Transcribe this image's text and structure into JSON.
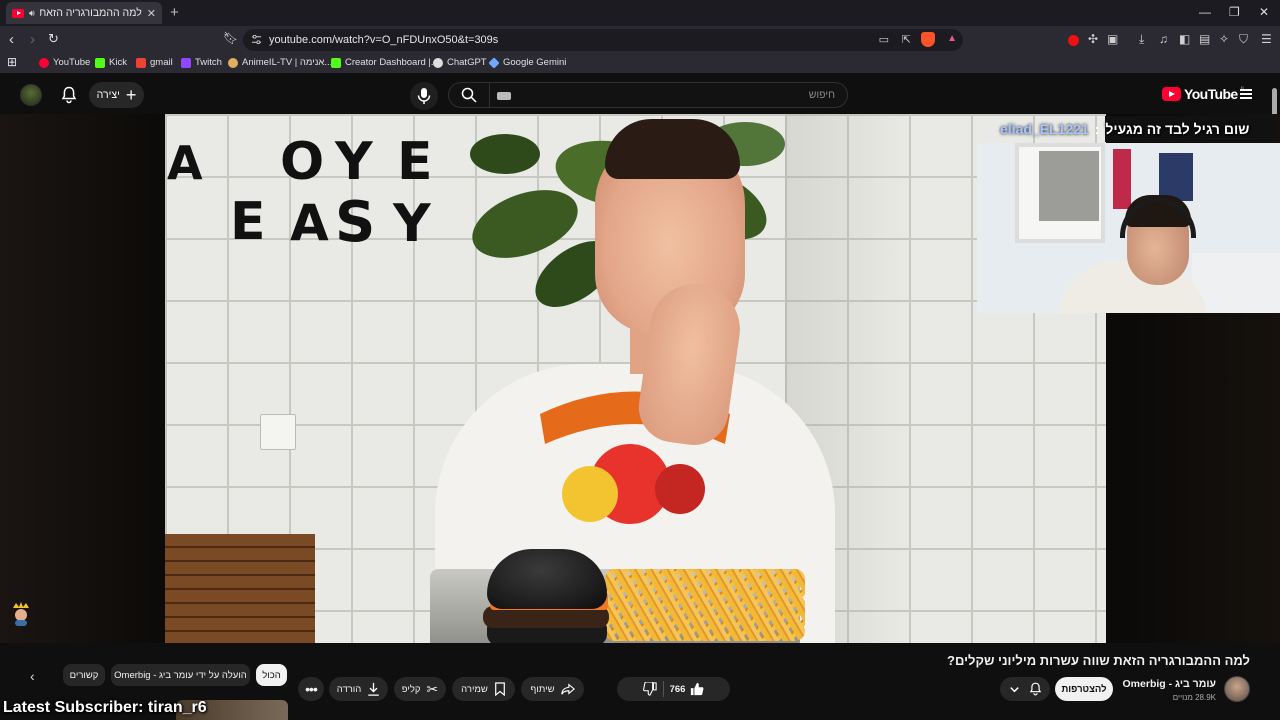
{
  "browser": {
    "tab_title": "למה ההמבורגריה הזאת שווה",
    "url": "youtube.com/watch?v=O_nFDUnxO50&t=309s",
    "bookmarks": [
      {
        "label": "YouTube",
        "color": "#ff0033"
      },
      {
        "label": "Kick",
        "color": "#53fc18"
      },
      {
        "label": "gmail",
        "color": "#ea4335"
      },
      {
        "label": "Twitch",
        "color": "#9146ff"
      },
      {
        "label": "AnimeIL-TV | אנימה...",
        "color": "#e0b060"
      },
      {
        "label": "Creator Dashboard |...",
        "color": "#53fc18"
      },
      {
        "label": "ChatGPT",
        "color": "#dddddd"
      },
      {
        "label": "Google Gemini",
        "color": "#6fa8ff"
      }
    ]
  },
  "youtube": {
    "create_label": "יצירה",
    "search_placeholder": "חיפוש",
    "logo_text": "YouTube",
    "logo_sup": "IL"
  },
  "overlay": {
    "chat_user": "eliad_EL1221",
    "chat_sep": ":",
    "chat_message": "שום רגיל לבד זה מגעיל",
    "video_wall_letters_1": [
      "A",
      "O",
      "Y",
      "E"
    ],
    "video_wall_letters_2": [
      "E",
      "A",
      "S",
      "Y"
    ],
    "latest_subscriber": "Latest Subscriber: tiran_r6"
  },
  "video": {
    "title": "למה ההמבורגריה הזאת שווה עשרות מיליוני שקלים?",
    "channel_name": "עומר ביג - Omerbig",
    "channel_subs": "28.9K מנויים",
    "join_label": "להצטרפות",
    "likes": "766",
    "share_label": "שיתוף",
    "save_label": "שמירה",
    "clip_label": "קליפ",
    "download_label": "הורדה"
  },
  "chips": [
    {
      "label": "הכול",
      "active": true
    },
    {
      "label": "הועלה על ידי עומר ביג - Omerbig",
      "active": false
    },
    {
      "label": "קשורים",
      "active": false
    }
  ],
  "colors": {
    "accent_red": "#ff0033",
    "background": "#0f0f0f",
    "pill": "#272727"
  }
}
